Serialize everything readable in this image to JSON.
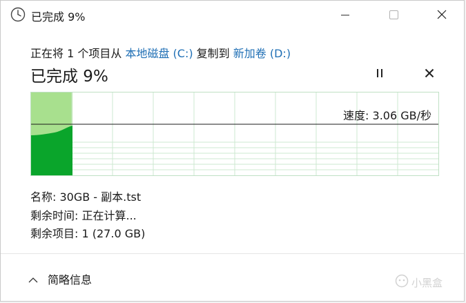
{
  "window": {
    "title": "已完成 9%",
    "controls": {
      "minimize": "minimize",
      "maximize": "maximize",
      "close": "close"
    }
  },
  "copy": {
    "prefix": "正在将 1 个项目从 ",
    "source": "本地磁盘 (C:)",
    "middle": " 复制到 ",
    "destination": "新加卷 (D:)"
  },
  "progress": {
    "title": "已完成 9%",
    "percent": 9,
    "speed": "速度: 3.06 GB/秒"
  },
  "details": {
    "name_label": "名称: ",
    "name_value": "30GB - 副本.tst",
    "time_label": "剩余时间: ",
    "time_value": "正在计算...",
    "items_label": "剩余项目: ",
    "items_value": "1 (27.0 GB)"
  },
  "footer": {
    "summary_label": "简略信息"
  },
  "watermark": {
    "text": "小黑盒"
  },
  "colors": {
    "progress_fill": "#a8e08e",
    "speed_fill": "#0aa52b",
    "grid": "#cde8d0",
    "link": "#1f6fb5"
  },
  "icons": {
    "title": "clock-icon",
    "pause": "pause-icon",
    "stop": "close-icon",
    "summary": "chevron-up-icon"
  }
}
